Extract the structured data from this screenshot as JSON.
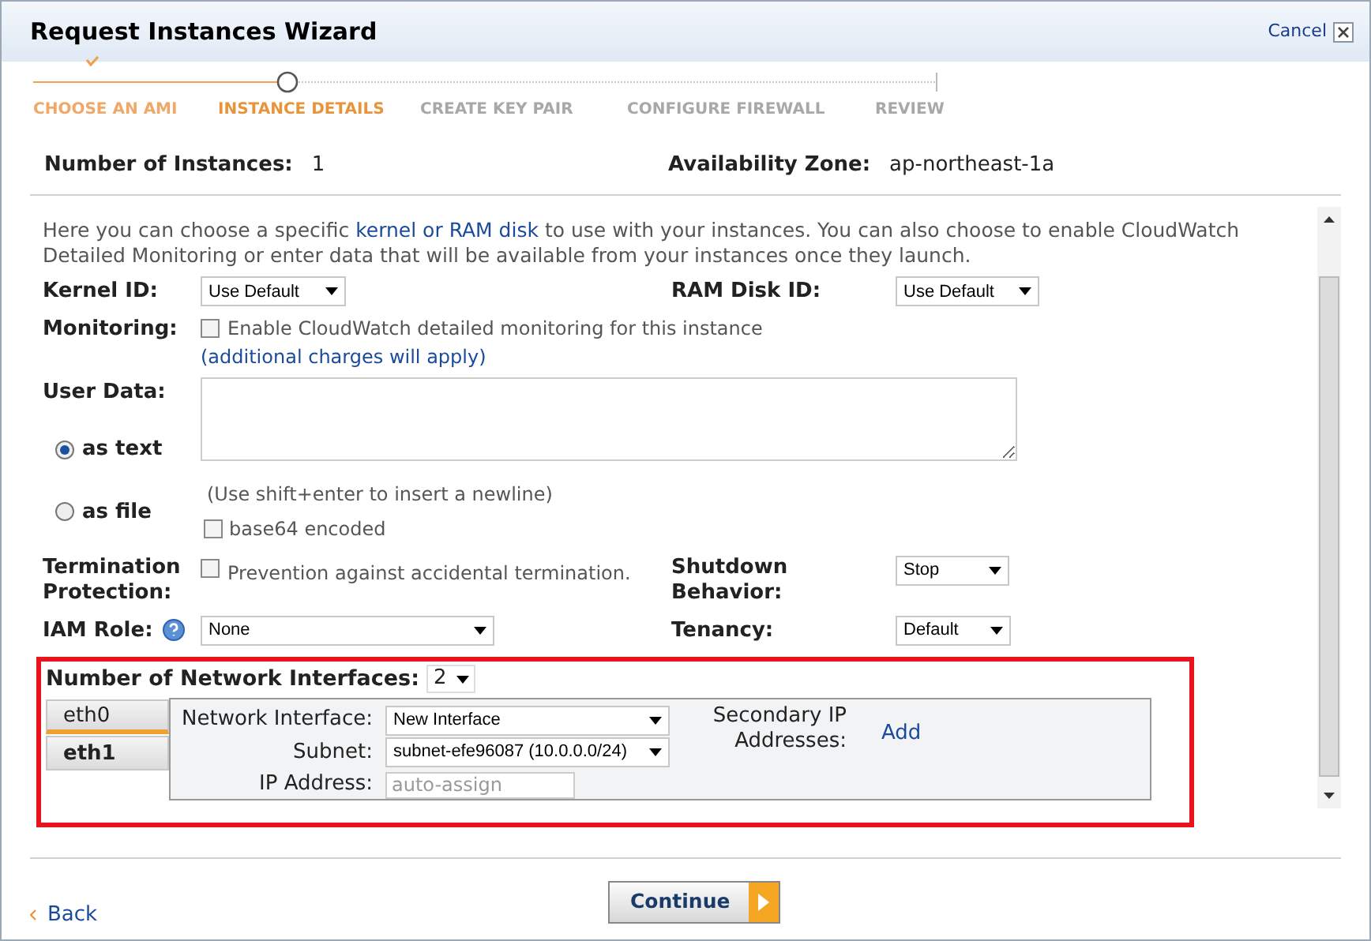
{
  "window": {
    "title": "Request Instances Wizard",
    "cancel": "Cancel"
  },
  "steps": [
    {
      "label": "CHOOSE AN AMI",
      "kind": "done"
    },
    {
      "label": "INSTANCE DETAILS",
      "kind": "current"
    },
    {
      "label": "CREATE KEY PAIR",
      "kind": "pending"
    },
    {
      "label": "CONFIGURE FIREWALL",
      "kind": "pending"
    },
    {
      "label": "REVIEW",
      "kind": "pending"
    }
  ],
  "summary": [
    {
      "label": "Number of Instances:",
      "value": "1"
    },
    {
      "label": "Availability Zone:",
      "value": "ap-northeast-1a"
    }
  ],
  "intro": {
    "before": "Here you can choose a specific ",
    "link": "kernel or RAM disk",
    "after": " to use with your instances. You can also choose to enable CloudWatch Detailed Monitoring or enter data that will be available from your instances once they launch."
  },
  "kernel_id": {
    "label": "Kernel ID:",
    "value": "Use Default"
  },
  "ram_disk_id": {
    "label": "RAM Disk ID:",
    "value": "Use Default"
  },
  "monitoring": {
    "label": "Monitoring:",
    "option": "Enable CloudWatch detailed monitoring for this instance",
    "checked": false,
    "note": "(additional charges will apply)"
  },
  "user_data": {
    "label": "User Data:",
    "formats": [
      {
        "label": "as text",
        "selected": true
      },
      {
        "label": "as file",
        "selected": false
      }
    ],
    "hint": "(Use shift+enter to insert a newline)",
    "base64": {
      "label": "base64 encoded",
      "checked": false
    }
  },
  "termination": {
    "label": "Termination Protection:",
    "option": "Prevention against accidental termination.",
    "checked": false
  },
  "shutdown": {
    "label": "Shutdown Behavior:",
    "value": "Stop"
  },
  "iam_role": {
    "label": "IAM Role:",
    "value": "None"
  },
  "tenancy": {
    "label": "Tenancy:",
    "value": "Default"
  },
  "network": {
    "label": "Number of Network Interfaces:",
    "count": "2",
    "tabs": [
      {
        "label": "eth0",
        "selected": true
      },
      {
        "label": "eth1",
        "selected": false
      }
    ],
    "interface": {
      "label": "Network Interface:",
      "value": "New Interface"
    },
    "subnet": {
      "label": "Subnet:",
      "value": "subnet-efe96087 (10.0.0.0/24)"
    },
    "ip": {
      "label": "IP Address:",
      "placeholder": "auto-assign"
    },
    "secondary": {
      "label": "Secondary IP Addresses:",
      "link": "Add"
    }
  },
  "back": "Back",
  "continue": "Continue"
}
